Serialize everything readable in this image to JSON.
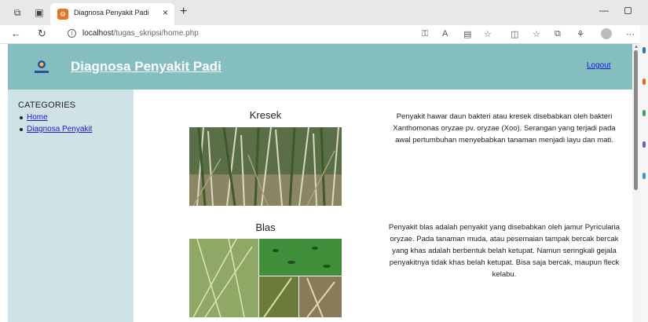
{
  "browser": {
    "tab_title": "Diagnosa Penyakit Padi",
    "tab_close": "×",
    "new_tab": "+",
    "url_host": "localhost",
    "url_path": "/tugas_skripsi/home.php",
    "icons": [
      "workspaces-icon",
      "tab-actions-icon",
      "favicon-icon",
      "back-icon",
      "refresh-icon",
      "info-icon",
      "read-aloud-icon",
      "immersive-reader-icon",
      "favorite-icon",
      "split-screen-icon",
      "favorites-icon",
      "collections-icon",
      "extensions-icon",
      "profile-icon",
      "more-icon"
    ]
  },
  "header": {
    "title": "Diagnosa Penyakit Padi",
    "logout": "Logout",
    "background": "#84bebf"
  },
  "sidebar": {
    "heading": "CATEGORIES",
    "items": [
      {
        "label": "Home"
      },
      {
        "label": "Diagnosa Penyakit"
      }
    ],
    "background": "#cfe3e6"
  },
  "diseases": [
    {
      "name": "Kresek",
      "description": "Penyakit hawar daun bakteri atau kresek disebabkan oleh bakteri Xanthomonas oryzae pv. oryzae (Xoo). Serangan yang terjadi pada awal pertumbuhan menyebabkan tanaman menjadi layu dan mati."
    },
    {
      "name": "Blas",
      "description": "Penyakit blas adalah penyakit yang disebabkan oleh jamur Pyricularia oryzae. Pada tanaman muda, atau pesemaian tampak bercak bercak yang khas adalah berbentuk belah ketupat. Namun seringkali gejala penyakitnya tidak khas belah ketupat. Bisa saja bercak, maupun fleck kelabu."
    }
  ]
}
